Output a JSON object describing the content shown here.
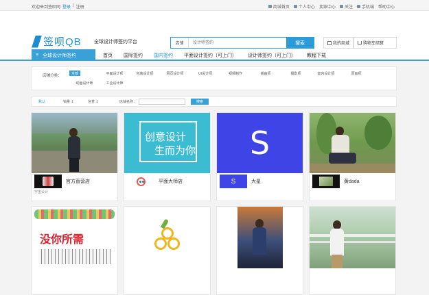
{
  "topbar": {
    "welcome": "欢迎来到签呗网",
    "login": "登录",
    "sep": "|",
    "register": "注册",
    "links": [
      "商城首页",
      "个人中心",
      "卖家中心",
      "关注",
      "手机端",
      "帮助中心"
    ]
  },
  "header": {
    "logo_text": "签呗QB",
    "tagline": "全球设计师签约平台",
    "search_scope": "店铺",
    "search_placeholder": "设计师签约",
    "search_button": "搜索",
    "my_mall": "我的商城",
    "cart": "购物车结算"
  },
  "nav": {
    "all_label": "全球设计师签约",
    "items": [
      "首页",
      "国际签约",
      "国内签约",
      "平面设计签约（可上门）",
      "设计师签约（可上门）",
      "教程下载"
    ]
  },
  "filter": {
    "label": "店铺分类：",
    "options": [
      "全部",
      "平面设计师",
      "包装设计师",
      "网页设计师",
      "UI设计师",
      "视频制作",
      "插画师",
      "摄影师",
      "室内设计师",
      "原画师",
      "动画设计师",
      "工业设计师"
    ]
  },
  "sortbar": {
    "sorts": [
      "默认",
      "销量",
      "信誉"
    ],
    "name_label": "店铺名称：",
    "search_button": "搜索"
  },
  "shops": [
    {
      "name": "官方直营店",
      "subtitle": "宇宙设计"
    },
    {
      "name": "平面大师店",
      "subtitle": ""
    },
    {
      "name": "大星",
      "subtitle": ""
    },
    {
      "name": "黄dada",
      "subtitle": ""
    }
  ],
  "card2_banner": {
    "line1": "创意设计",
    "line2": "生而为你"
  },
  "card5_banner": "没你所需",
  "colors": {
    "accent": "#3aa0d8",
    "purple": "#3e44e6",
    "teal": "#3bbcd2"
  }
}
